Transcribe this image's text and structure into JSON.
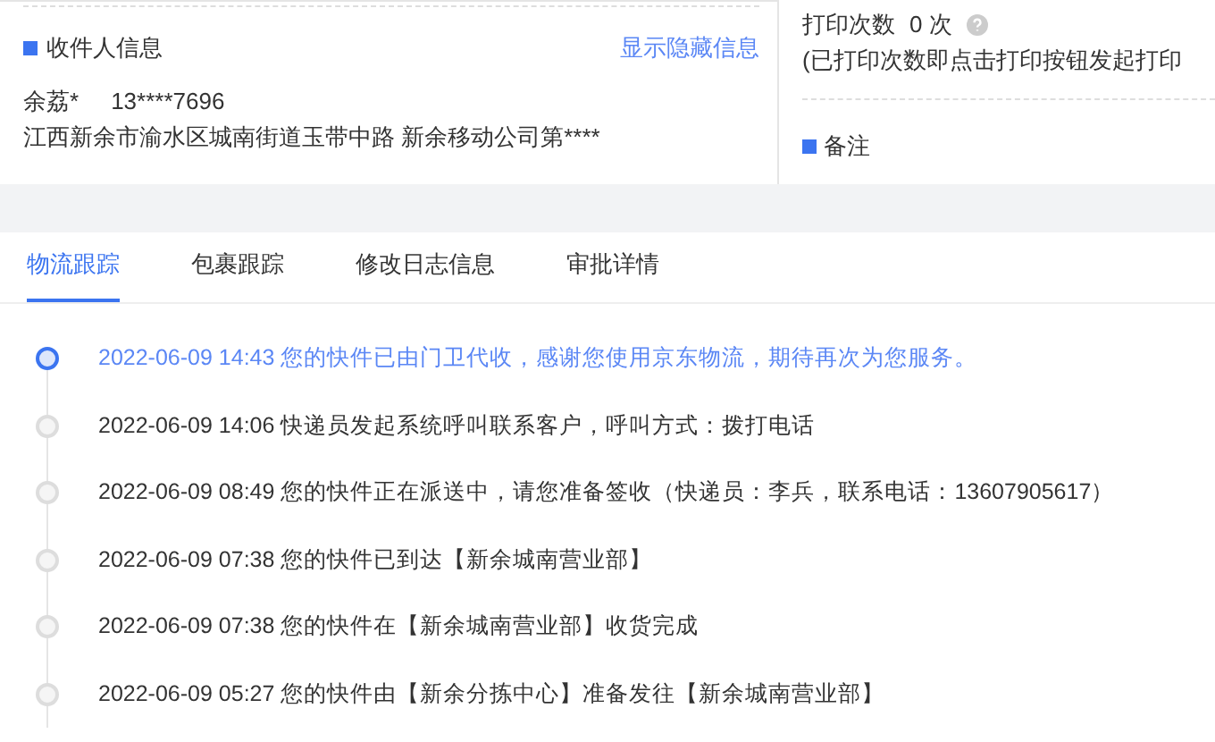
{
  "recipient": {
    "title": "收件人信息",
    "toggle_link": "显示隐藏信息",
    "name": "余荔*",
    "phone": "13****7696",
    "address": "江西新余市渝水区城南街道玉带中路 新余移动公司第****"
  },
  "print": {
    "label": "打印次数",
    "count": "0 次",
    "note": "(已打印次数即点击打印按钮发起打印"
  },
  "remark": {
    "title": "备注"
  },
  "tabs": [
    {
      "label": "物流跟踪",
      "selected": true
    },
    {
      "label": "包裹跟踪",
      "selected": false
    },
    {
      "label": "修改日志信息",
      "selected": false
    },
    {
      "label": "审批详情",
      "selected": false
    }
  ],
  "timeline": [
    {
      "time": "2022-06-09 14:43",
      "text": "您的快件已由门卫代收，感谢您使用京东物流，期待再次为您服务。",
      "active": true
    },
    {
      "time": "2022-06-09 14:06",
      "text": "快递员发起系统呼叫联系客户，呼叫方式：拨打电话",
      "active": false
    },
    {
      "time": "2022-06-09 08:49",
      "text": "您的快件正在派送中，请您准备签收（快递员：李兵，联系电话：13607905617）",
      "active": false
    },
    {
      "time": "2022-06-09 07:38",
      "text": "您的快件已到达【新余城南营业部】",
      "active": false
    },
    {
      "time": "2022-06-09 07:38",
      "text": "您的快件在【新余城南营业部】收货完成",
      "active": false
    },
    {
      "time": "2022-06-09 05:27",
      "text": "您的快件由【新余分拣中心】准备发往【新余城南营业部】",
      "active": false
    }
  ]
}
